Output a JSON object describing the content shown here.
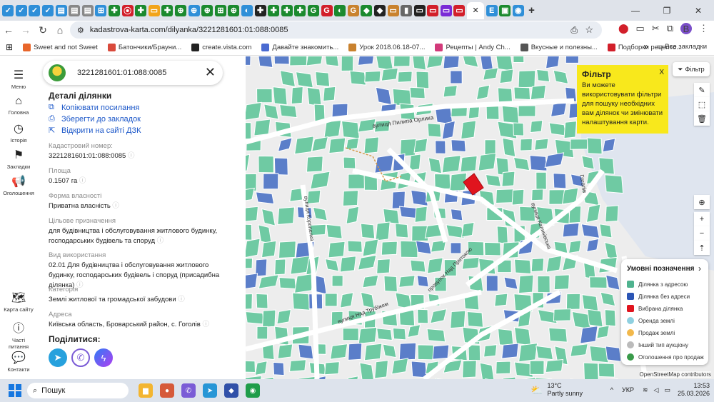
{
  "browser": {
    "active_tab_close": "✕",
    "new_tab": "+",
    "url": "kadastrova-karta.com/dilyanka/3221281601:01:088:0085",
    "bookmarks": [
      {
        "label": "Sweet and not Sweet",
        "color": "#e8662b"
      },
      {
        "label": "Батончики/Брауни...",
        "color": "#d94a3c"
      },
      {
        "label": "create.vista.com",
        "color": "#222"
      },
      {
        "label": "Давайте знакомить...",
        "color": "#4a6bd1"
      },
      {
        "label": "Урок 2018.06.18-07...",
        "color": "#c9822e"
      },
      {
        "label": "Рецепты | Andy Ch...",
        "color": "#d23a7a"
      },
      {
        "label": "Вкусные и полезны...",
        "color": "#555"
      },
      {
        "label": "Подборки рецепто...",
        "color": "#d21f2a"
      }
    ],
    "all_bookmarks": "Все закладки",
    "avatar_letter": "B"
  },
  "rail": {
    "menu": "Меню",
    "home": "Головна",
    "history": "Історія",
    "bookmarks": "Закладки",
    "ads": "Оголошення",
    "map": "Карта сайту",
    "faq": "Часті питання",
    "contacts": "Контакти"
  },
  "panel": {
    "search_value": "3221281601:01:088:0085",
    "details_title": "Деталі ділянки",
    "copy_link": "Копіювати посилання",
    "save_bookmark": "Зберегти до закладок",
    "open_dzk": "Відкрити на сайті ДЗК",
    "fields": [
      {
        "label": "Кадастровий номер:",
        "value": "3221281601:01:088:0085"
      },
      {
        "label": "Площа",
        "value": "0.1507 га"
      },
      {
        "label": "Форма власності",
        "value": "Приватна власність"
      },
      {
        "label": "Цільове призначення",
        "value": "для будівництва і обслуговування житлового будинку, господарських будівель та споруд"
      },
      {
        "label": "Вид використання",
        "value": "02.01 Для будівництва і обслуговування житлового будинку, господарських будівель і споруд (присадибна ділянка)"
      },
      {
        "label": "Категорія",
        "value": "Землі житлової та громадської забудови"
      },
      {
        "label": "Адреса",
        "value": "Київська область, Броварський район, с. Гоголів"
      }
    ],
    "share_title": "Поділитися:"
  },
  "map": {
    "filter_button": "Фільтр",
    "tooltip_title": "Фільтр",
    "tooltip_body": "Ви можете використовувати фільтри для пошуку необхідних вам ділянок чи змінювати налаштування карти.",
    "tooltip_close": "X",
    "streets": [
      "вулиця Пилипа Орлика",
      "Гоголів",
      "вулиця Короленка",
      "вулиця Калинівська",
      "провулок Над Притокою",
      "вулиця Над Трубіжем"
    ],
    "legend_title": "Умовні позначення",
    "legend": [
      {
        "label": "Ділянка з адресою",
        "color": "#4fb38f"
      },
      {
        "label": "Ділянка без адреси",
        "color": "#2b55b5"
      },
      {
        "label": "Вибрана ділянка",
        "color": "#e0141e"
      },
      {
        "label": "Оренда землі",
        "color": "#8fd0e0"
      },
      {
        "label": "Продаж землі",
        "color": "#f2b84b"
      },
      {
        "label": "Інший тип аукціону",
        "color": "#bbbbbb"
      },
      {
        "label": "Оголошення про продаж",
        "color": "#3a9b4a"
      }
    ],
    "attribution": "OpenStreetMap contributors"
  },
  "taskbar": {
    "search": "Пошук",
    "temp": "13°C",
    "weather": "Partly sunny",
    "lang": "УКР",
    "time": "13:53",
    "date": "25.03.2026"
  },
  "colors": {
    "parcel_green": "#6fcaa3",
    "parcel_blue": "#5b7ec9",
    "selected": "#e0141e",
    "link": "#1a56c8"
  }
}
